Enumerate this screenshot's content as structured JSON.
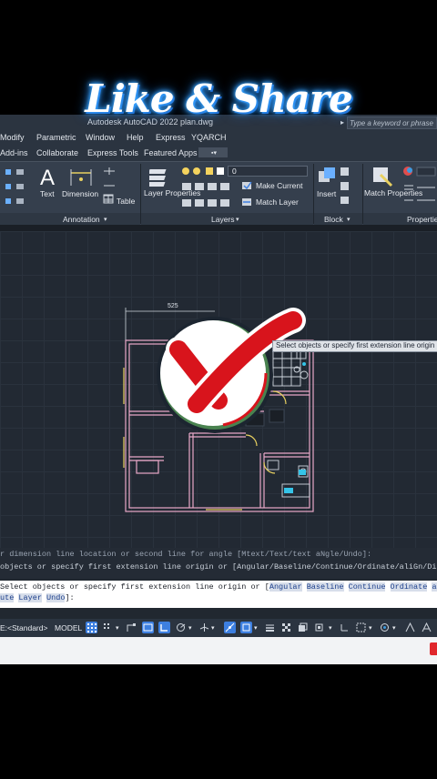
{
  "overlay": {
    "title": "Like & Share"
  },
  "titlebar": {
    "app_title": "Autodesk AutoCAD 2022",
    "file_name": "plan.dwg",
    "search_placeholder": "Type a keyword or phrase"
  },
  "menu": [
    "Modify",
    "Parametric",
    "Window",
    "Help",
    "Express",
    "YQARCH"
  ],
  "tabs": [
    "Add-ins",
    "Collaborate",
    "Express Tools",
    "Featured Apps"
  ],
  "ribbon": {
    "text_label": "Text",
    "dimension_label": "Dimension",
    "table_label": "Table",
    "layer_properties_label": "Layer Properties",
    "layer_value": "0",
    "make_current_label": "Make Current",
    "match_layer_label": "Match Layer",
    "insert_label": "Insert",
    "match_properties_label": "Match Properties",
    "panels": {
      "annotation": "Annotation",
      "layers": "Layers",
      "block": "Block",
      "properties": "Properties"
    }
  },
  "drawing": {
    "dimension_text": "525",
    "tooltip": "Select objects or specify first extension line origin"
  },
  "command": {
    "history_1": "r dimension line location or second line for angle [Mtext/Text/text aNgle/Undo]:",
    "history_2": "objects or specify first extension line origin or [Angular/Baseline/Continue/Ordinate/aliGn/Dist",
    "prompt_prefix": "Select objects or specify first extension line origin or [",
    "options_line1": [
      "Angular",
      "Baseline",
      "Continue",
      "Ordinate",
      "ali"
    ],
    "options_line2": [
      "ute",
      "Layer",
      "Undo"
    ],
    "prompt_suffix": "]:"
  },
  "status": {
    "style_label": "E:<Standard>",
    "model_label": "MODEL"
  },
  "colors": {
    "accent_blue": "#3d7fe0",
    "wall_pink": "#e8a8c8",
    "wall_yellow": "#e8d060",
    "check_red": "#d8141c"
  }
}
